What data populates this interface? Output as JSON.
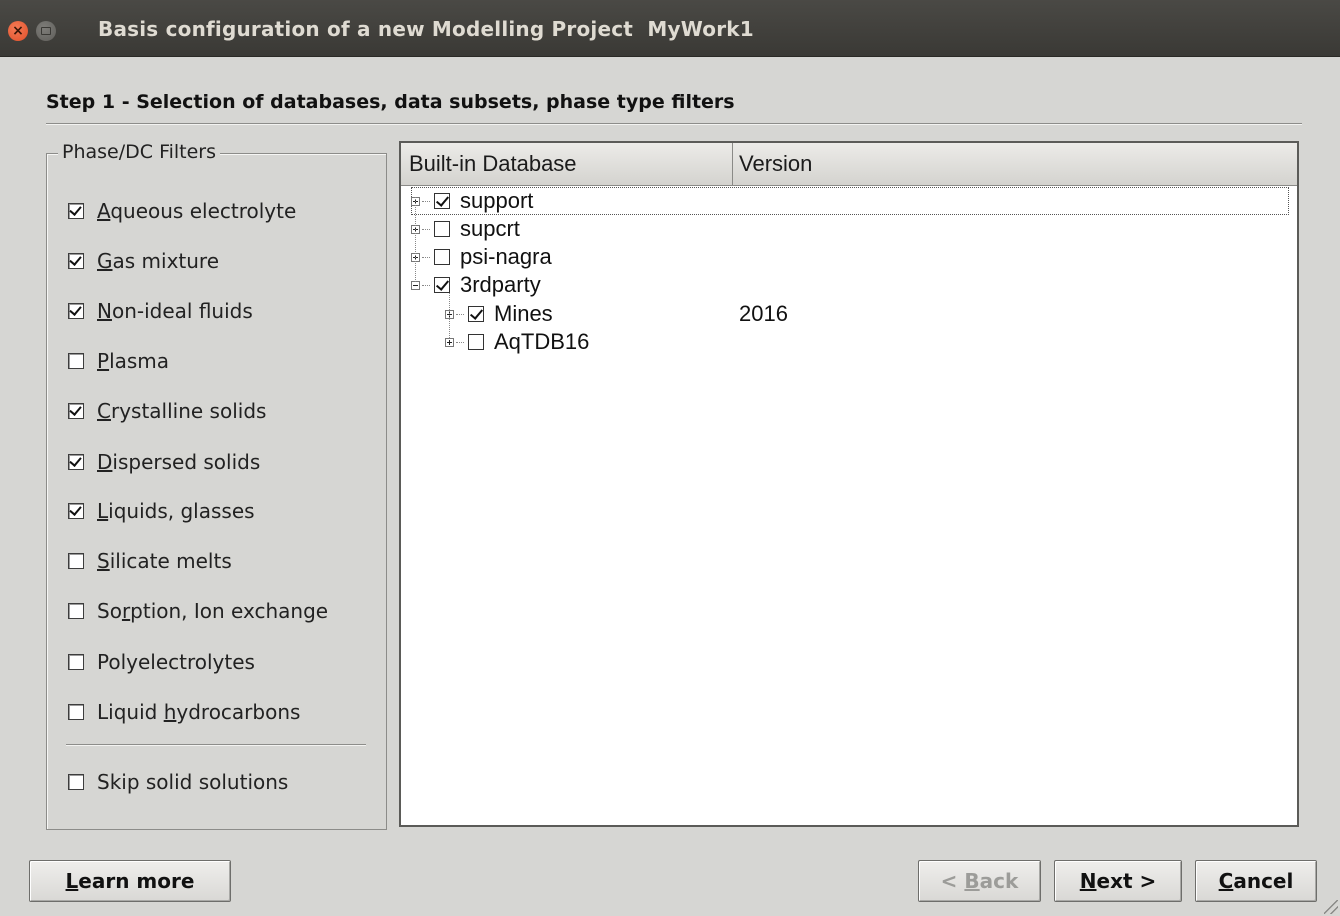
{
  "window": {
    "title": "Basis configuration of a new Modelling Project  MyWork1"
  },
  "step_title": "Step 1 - Selection of databases, data subsets, phase type filters",
  "filters": {
    "group_title": "Phase/DC Filters",
    "items": [
      {
        "label": "Aqueous electrolyte",
        "mnemonic": "A",
        "checked": true
      },
      {
        "label": "Gas mixture",
        "mnemonic": "G",
        "checked": true
      },
      {
        "label": "Non-ideal fluids",
        "mnemonic": "N",
        "checked": true
      },
      {
        "label": "Plasma",
        "mnemonic": "P",
        "checked": false
      },
      {
        "label": "Crystalline solids",
        "mnemonic": "C",
        "checked": true
      },
      {
        "label": "Dispersed solids",
        "mnemonic": "D",
        "checked": true
      },
      {
        "label": "Liquids, glasses",
        "mnemonic": "L",
        "checked": true
      },
      {
        "label": "Silicate melts",
        "mnemonic": "S",
        "checked": false
      },
      {
        "label": "Sorption, Ion exchange",
        "mnemonic": "r",
        "checked": false
      },
      {
        "label": "Polyelectrolytes",
        "mnemonic": "",
        "checked": false
      },
      {
        "label": "Liquid hydrocarbons",
        "mnemonic": "h",
        "checked": false
      }
    ],
    "skip_solid_solutions": {
      "label": "Skip solid solutions",
      "checked": false
    }
  },
  "tree": {
    "columns": [
      "Built-in Database",
      "Version"
    ],
    "rows": [
      {
        "label": "support",
        "version": "",
        "level": 0,
        "expander": "plus",
        "checked": true,
        "selected": true
      },
      {
        "label": "supcrt",
        "version": "",
        "level": 0,
        "expander": "plus",
        "checked": false,
        "selected": false
      },
      {
        "label": "psi-nagra",
        "version": "",
        "level": 0,
        "expander": "plus",
        "checked": false,
        "selected": false
      },
      {
        "label": "3rdparty",
        "version": "",
        "level": 0,
        "expander": "minus",
        "checked": true,
        "selected": false
      },
      {
        "label": "Mines",
        "version": "2016",
        "level": 1,
        "expander": "plus",
        "checked": true,
        "selected": false
      },
      {
        "label": "AqTDB16",
        "version": "",
        "level": 1,
        "expander": "plus",
        "checked": false,
        "selected": false
      }
    ]
  },
  "buttons": {
    "learn_more": {
      "mn": "L",
      "rest": "earn more"
    },
    "back": {
      "pre": "< ",
      "mn": "B",
      "rest": "ack",
      "enabled": false
    },
    "next": {
      "mn": "N",
      "rest": "ext >"
    },
    "cancel": {
      "mn": "C",
      "rest": "ancel"
    }
  },
  "colors": {
    "window_bg": "#d6d6d3",
    "titlebar": "#3d3c38",
    "close_button": "#e9582f",
    "tree_bg": "#ffffff"
  }
}
